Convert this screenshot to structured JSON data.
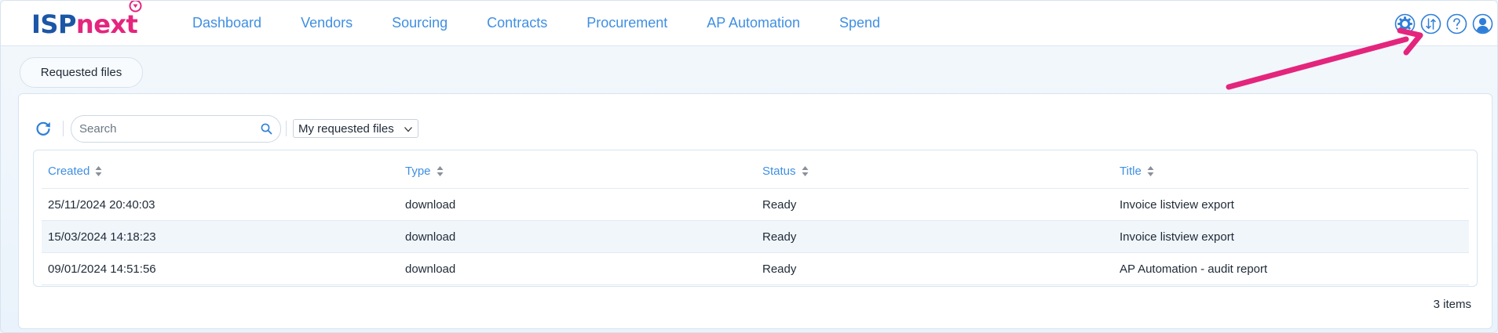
{
  "brand": {
    "logo_part1": "ISP",
    "logo_part2": "next",
    "color_primary": "#1c56a6",
    "color_accent": "#e4257d"
  },
  "nav": {
    "items": [
      {
        "label": "Dashboard"
      },
      {
        "label": "Vendors"
      },
      {
        "label": "Sourcing"
      },
      {
        "label": "Contracts"
      },
      {
        "label": "Procurement"
      },
      {
        "label": "AP Automation"
      },
      {
        "label": "Spend"
      }
    ],
    "link_color": "#3f8fe3"
  },
  "top_icons": [
    "gear-icon",
    "transfer-arrows-icon",
    "help-icon",
    "user-icon"
  ],
  "tab": {
    "label": "Requested files"
  },
  "toolbar": {
    "search_placeholder": "Search",
    "filter_value": "My requested files"
  },
  "table": {
    "columns": [
      {
        "label": "Created"
      },
      {
        "label": "Type"
      },
      {
        "label": "Status"
      },
      {
        "label": "Title"
      }
    ],
    "rows": [
      {
        "created": "25/11/2024 20:40:03",
        "type": "download",
        "status": "Ready",
        "title": "Invoice listview export"
      },
      {
        "created": "15/03/2024 14:18:23",
        "type": "download",
        "status": "Ready",
        "title": "Invoice listview export"
      },
      {
        "created": "09/01/2024 14:51:56",
        "type": "download",
        "status": "Ready",
        "title": "AP Automation - audit report"
      }
    ],
    "count_label": "3 items"
  },
  "annotation": {
    "arrow_color": "#e4257d",
    "points_to": "transfer-arrows-icon"
  }
}
